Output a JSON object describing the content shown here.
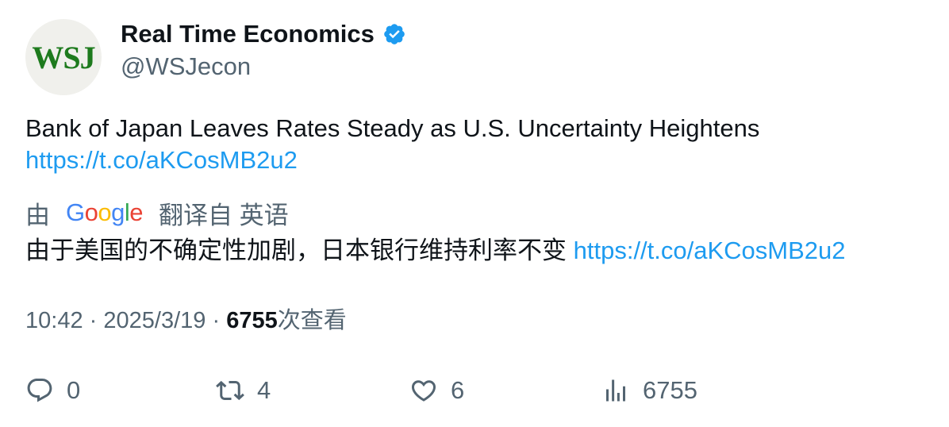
{
  "author": {
    "avatar_text": "WSJ",
    "display_name": "Real Time Economics",
    "handle": "@WSJecon",
    "verified_icon": "verified-badge-icon"
  },
  "tweet": {
    "text": "Bank of Japan Leaves Rates Steady as U.S. Uncertainty Heightens",
    "link": "https://t.co/aKCosMB2u2"
  },
  "translation": {
    "prefix": "由",
    "google_letters": [
      "G",
      "o",
      "o",
      "g",
      "l",
      "e"
    ],
    "suffix": "翻译自 英语",
    "text": "由于美国的不确定性加剧，日本银行维持利率不变",
    "link": "https://t.co/aKCosMB2u2"
  },
  "meta": {
    "time": "10:42",
    "separator": "·",
    "date": "2025/3/19",
    "views_count": "6755",
    "views_label": "次查看"
  },
  "actions": {
    "reply_count": "0",
    "retweet_count": "4",
    "like_count": "6",
    "views_count": "6755"
  },
  "colors": {
    "link": "#1d9bf0",
    "secondary_text": "#536471",
    "primary_text": "#0f1419",
    "verified": "#1d9bf0",
    "wsj_green": "#1d7a1d"
  }
}
